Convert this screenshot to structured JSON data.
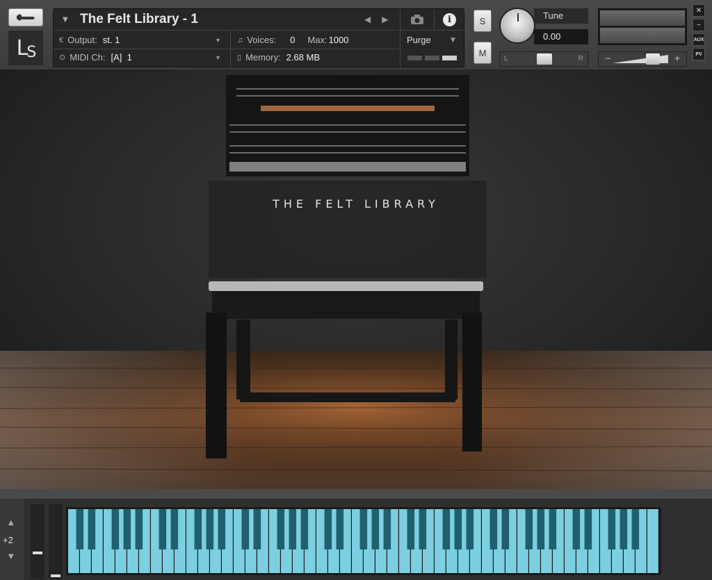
{
  "header": {
    "instrument_title": "The Felt Library - 1",
    "output_label": "Output:",
    "output_value": "st. 1",
    "voices_label": "Voices:",
    "voices_value": "0",
    "max_label": "Max:",
    "max_value": "1000",
    "midi_label": "MIDI Ch:",
    "midi_value": "[A]  1",
    "memory_label": "Memory:",
    "memory_value": "2.68 MB",
    "purge_label": "Purge",
    "solo_label": "S",
    "mute_label": "M",
    "tune_label": "Tune",
    "tune_value": "0.00",
    "pan_left": "L",
    "pan_right": "R",
    "vol_minus": "−",
    "vol_plus": "+",
    "logo_text": "L",
    "logo_sub": "S",
    "close_label": "✕",
    "minimize_label": "−",
    "aux_label": "AUX",
    "pv_label": "PV"
  },
  "artwork": {
    "title": "THE FELT LIBRARY"
  },
  "keyboard": {
    "octave_offset": "+2",
    "key_color": "#7ccfe0",
    "num_white_keys": 50
  },
  "colors": {
    "panel": "#262626",
    "key_white": "#7ccfe0",
    "key_black": "#1f5f70"
  }
}
